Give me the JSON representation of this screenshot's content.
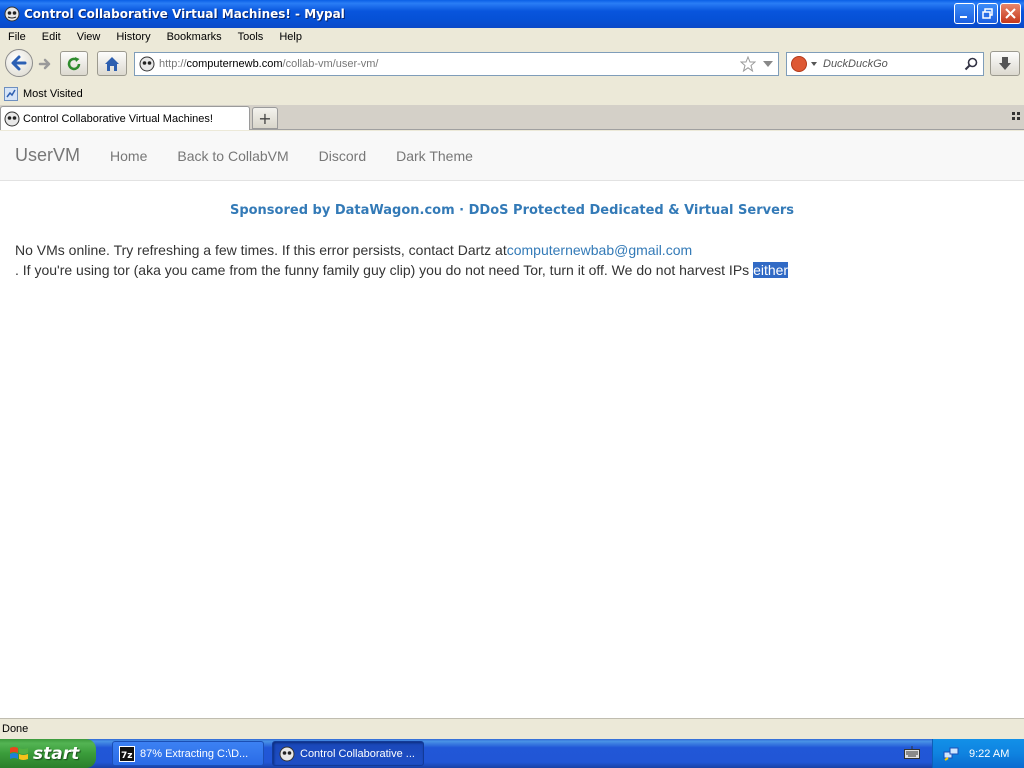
{
  "window": {
    "title": "Control Collaborative Virtual Machines! - Mypal"
  },
  "menu": [
    "File",
    "Edit",
    "View",
    "History",
    "Bookmarks",
    "Tools",
    "Help"
  ],
  "address_bar": {
    "protocol": "http://",
    "host": "computernewb.com",
    "path": "/collab-vm/user-vm/"
  },
  "search": {
    "placeholder": "DuckDuckGo"
  },
  "bookmarks": {
    "most_visited": "Most Visited"
  },
  "tab": {
    "title": "Control Collaborative Virtual Machines!",
    "new_tab": "+"
  },
  "site": {
    "brand": "UserVM",
    "nav": [
      "Home",
      "Back to CollabVM",
      "Discord",
      "Dark Theme"
    ],
    "sponsor": "Sponsored by DataWagon.com · DDoS Protected Dedicated & Virtual Servers",
    "message_part1": "No VMs online. Try refreshing a few times. If this error persists, contact Dartz at",
    "email": "computernewbab@gmail.com",
    "message_part2": ". If you're using tor (aka you came from the funny family guy clip) you do not need Tor, turn it off. We do not harvest IPs ",
    "message_selected": "either"
  },
  "status": {
    "text": "Done"
  },
  "taskbar": {
    "start_label": "start",
    "tasks": [
      {
        "label": "87% Extracting C:\\D...",
        "active": false
      },
      {
        "label": "Control Collaborative ...",
        "active": true
      }
    ],
    "clock": "9:22 AM"
  },
  "colors": {
    "link": "#337ab7",
    "selection": "#316ac5",
    "titlebar": "#0855dd",
    "taskbar": "#2157d7"
  }
}
